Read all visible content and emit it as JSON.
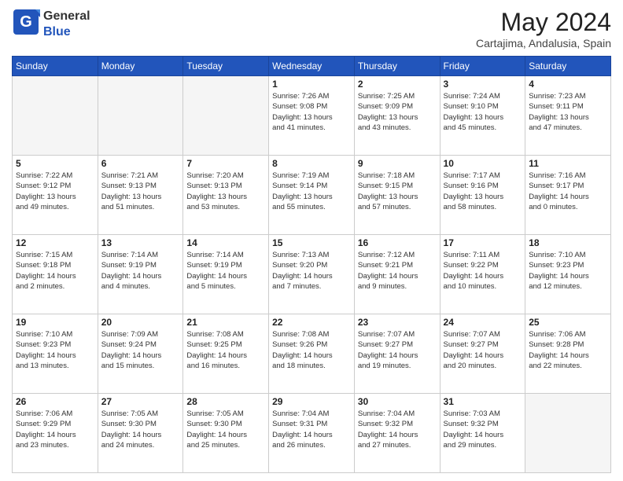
{
  "header": {
    "logo_general": "General",
    "logo_blue": "Blue",
    "month_year": "May 2024",
    "location": "Cartajima, Andalusia, Spain"
  },
  "days_of_week": [
    "Sunday",
    "Monday",
    "Tuesday",
    "Wednesday",
    "Thursday",
    "Friday",
    "Saturday"
  ],
  "weeks": [
    [
      {
        "day": "",
        "info": ""
      },
      {
        "day": "",
        "info": ""
      },
      {
        "day": "",
        "info": ""
      },
      {
        "day": "1",
        "info": "Sunrise: 7:26 AM\nSunset: 9:08 PM\nDaylight: 13 hours\nand 41 minutes."
      },
      {
        "day": "2",
        "info": "Sunrise: 7:25 AM\nSunset: 9:09 PM\nDaylight: 13 hours\nand 43 minutes."
      },
      {
        "day": "3",
        "info": "Sunrise: 7:24 AM\nSunset: 9:10 PM\nDaylight: 13 hours\nand 45 minutes."
      },
      {
        "day": "4",
        "info": "Sunrise: 7:23 AM\nSunset: 9:11 PM\nDaylight: 13 hours\nand 47 minutes."
      }
    ],
    [
      {
        "day": "5",
        "info": "Sunrise: 7:22 AM\nSunset: 9:12 PM\nDaylight: 13 hours\nand 49 minutes."
      },
      {
        "day": "6",
        "info": "Sunrise: 7:21 AM\nSunset: 9:13 PM\nDaylight: 13 hours\nand 51 minutes."
      },
      {
        "day": "7",
        "info": "Sunrise: 7:20 AM\nSunset: 9:13 PM\nDaylight: 13 hours\nand 53 minutes."
      },
      {
        "day": "8",
        "info": "Sunrise: 7:19 AM\nSunset: 9:14 PM\nDaylight: 13 hours\nand 55 minutes."
      },
      {
        "day": "9",
        "info": "Sunrise: 7:18 AM\nSunset: 9:15 PM\nDaylight: 13 hours\nand 57 minutes."
      },
      {
        "day": "10",
        "info": "Sunrise: 7:17 AM\nSunset: 9:16 PM\nDaylight: 13 hours\nand 58 minutes."
      },
      {
        "day": "11",
        "info": "Sunrise: 7:16 AM\nSunset: 9:17 PM\nDaylight: 14 hours\nand 0 minutes."
      }
    ],
    [
      {
        "day": "12",
        "info": "Sunrise: 7:15 AM\nSunset: 9:18 PM\nDaylight: 14 hours\nand 2 minutes."
      },
      {
        "day": "13",
        "info": "Sunrise: 7:14 AM\nSunset: 9:19 PM\nDaylight: 14 hours\nand 4 minutes."
      },
      {
        "day": "14",
        "info": "Sunrise: 7:14 AM\nSunset: 9:19 PM\nDaylight: 14 hours\nand 5 minutes."
      },
      {
        "day": "15",
        "info": "Sunrise: 7:13 AM\nSunset: 9:20 PM\nDaylight: 14 hours\nand 7 minutes."
      },
      {
        "day": "16",
        "info": "Sunrise: 7:12 AM\nSunset: 9:21 PM\nDaylight: 14 hours\nand 9 minutes."
      },
      {
        "day": "17",
        "info": "Sunrise: 7:11 AM\nSunset: 9:22 PM\nDaylight: 14 hours\nand 10 minutes."
      },
      {
        "day": "18",
        "info": "Sunrise: 7:10 AM\nSunset: 9:23 PM\nDaylight: 14 hours\nand 12 minutes."
      }
    ],
    [
      {
        "day": "19",
        "info": "Sunrise: 7:10 AM\nSunset: 9:23 PM\nDaylight: 14 hours\nand 13 minutes."
      },
      {
        "day": "20",
        "info": "Sunrise: 7:09 AM\nSunset: 9:24 PM\nDaylight: 14 hours\nand 15 minutes."
      },
      {
        "day": "21",
        "info": "Sunrise: 7:08 AM\nSunset: 9:25 PM\nDaylight: 14 hours\nand 16 minutes."
      },
      {
        "day": "22",
        "info": "Sunrise: 7:08 AM\nSunset: 9:26 PM\nDaylight: 14 hours\nand 18 minutes."
      },
      {
        "day": "23",
        "info": "Sunrise: 7:07 AM\nSunset: 9:27 PM\nDaylight: 14 hours\nand 19 minutes."
      },
      {
        "day": "24",
        "info": "Sunrise: 7:07 AM\nSunset: 9:27 PM\nDaylight: 14 hours\nand 20 minutes."
      },
      {
        "day": "25",
        "info": "Sunrise: 7:06 AM\nSunset: 9:28 PM\nDaylight: 14 hours\nand 22 minutes."
      }
    ],
    [
      {
        "day": "26",
        "info": "Sunrise: 7:06 AM\nSunset: 9:29 PM\nDaylight: 14 hours\nand 23 minutes."
      },
      {
        "day": "27",
        "info": "Sunrise: 7:05 AM\nSunset: 9:30 PM\nDaylight: 14 hours\nand 24 minutes."
      },
      {
        "day": "28",
        "info": "Sunrise: 7:05 AM\nSunset: 9:30 PM\nDaylight: 14 hours\nand 25 minutes."
      },
      {
        "day": "29",
        "info": "Sunrise: 7:04 AM\nSunset: 9:31 PM\nDaylight: 14 hours\nand 26 minutes."
      },
      {
        "day": "30",
        "info": "Sunrise: 7:04 AM\nSunset: 9:32 PM\nDaylight: 14 hours\nand 27 minutes."
      },
      {
        "day": "31",
        "info": "Sunrise: 7:03 AM\nSunset: 9:32 PM\nDaylight: 14 hours\nand 29 minutes."
      },
      {
        "day": "",
        "info": ""
      }
    ]
  ]
}
